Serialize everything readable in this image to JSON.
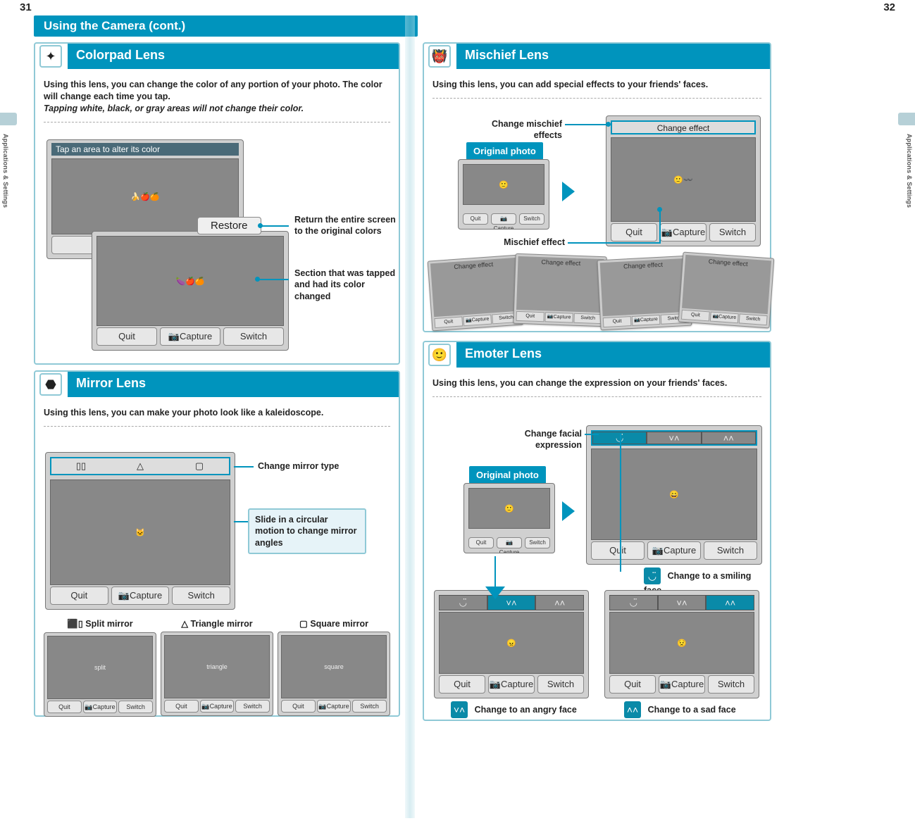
{
  "page_left_num": "31",
  "page_right_num": "32",
  "side_label": "Applications & Settings",
  "main_title": "Using the Camera (cont.)",
  "btnbar": {
    "quit": "Quit",
    "capture": "📷Capture",
    "switch": "Switch"
  },
  "colorpad": {
    "title": "Colorpad Lens",
    "intro_main": "Using this lens, you can change the color of any portion of your photo. The color will change each time you tap.",
    "intro_ital": "Tapping white, black, or gray areas will not change their color.",
    "screen_text": "Tap an area to alter its color",
    "restore_btn": "Restore",
    "callout_restore": "Return the entire screen to the original colors",
    "callout_tapped": "Section that was tapped and had its color changed"
  },
  "mirror": {
    "title": "Mirror Lens",
    "intro": "Using this lens, you can make your photo look like a kaleidoscope.",
    "callout_type": "Change mirror type",
    "callout_slide": "Slide in a circular motion to change mirror angles",
    "types": {
      "split": "Split mirror",
      "triangle": "Triangle mirror",
      "square": "Square mirror",
      "sym_split": "⬛▯",
      "sym_tri": "△",
      "sym_sq": "▢"
    }
  },
  "mischief": {
    "title": "Mischief Lens",
    "intro": "Using this lens, you can add special effects to your friends' faces.",
    "callout_change": "Change mischief effects",
    "badge_original": "Original photo",
    "callout_effect": "Mischief effect",
    "change_effect_label": "Change effect",
    "thumb_label": "Change effect"
  },
  "emoter": {
    "title": "Emoter Lens",
    "intro": "Using this lens, you can change the expression on your friends' faces.",
    "callout_facial": "Change facial expression",
    "badge_original": "Original photo",
    "smile": "Change to a smiling face",
    "angry": "Change to an angry face",
    "sad": "Change to a sad face"
  }
}
